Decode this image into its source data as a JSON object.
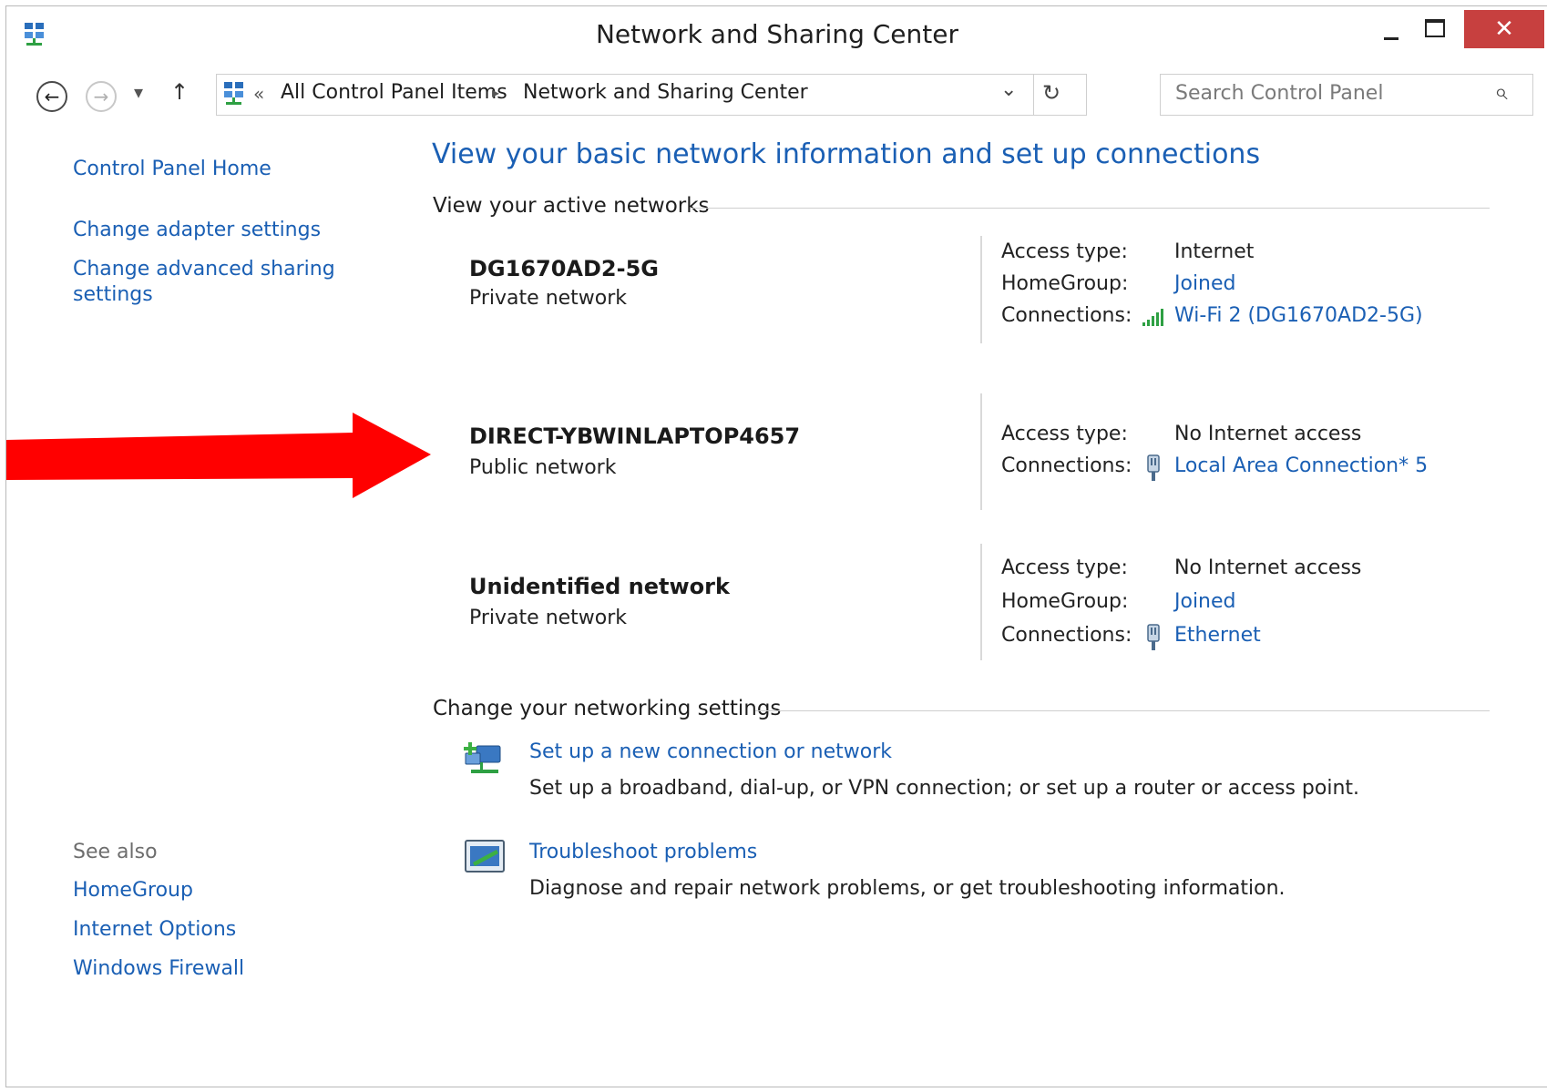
{
  "window": {
    "title": "Network and Sharing Center",
    "close_glyph": "✕"
  },
  "nav": {
    "back_glyph": "←",
    "forward_glyph": "→",
    "recent_glyph": "▾",
    "up_glyph": "↑",
    "breadcrumb_sep": "«",
    "crumb_arrow": "▸",
    "crumbs": [
      "All Control Panel Items",
      "Network and Sharing Center"
    ],
    "dropdown_glyph": "⌄",
    "refresh_glyph": "↻",
    "search_placeholder": "Search Control Panel",
    "search_glyph": "⌕"
  },
  "sidebar": {
    "home": "Control Panel Home",
    "adapter": "Change adapter settings",
    "advanced_line1": "Change advanced sharing",
    "advanced_line2": "settings",
    "see_also_label": "See also",
    "see_also": [
      "HomeGroup",
      "Internet Options",
      "Windows Firewall"
    ]
  },
  "main": {
    "heading": "View your basic network information and set up connections",
    "active_label": "View your active networks",
    "networks": [
      {
        "name": "DG1670AD2-5G",
        "type": "Private network",
        "access_label": "Access type:",
        "access": "Internet",
        "homegroup_label": "HomeGroup:",
        "homegroup": "Joined",
        "conn_label": "Connections:",
        "conn": "Wi-Fi 2 (DG1670AD2-5G)",
        "conn_icon": "wifi-signal-icon"
      },
      {
        "name": "DIRECT-YBWINLAPTOP4657",
        "type": "Public network",
        "access_label": "Access type:",
        "access": "No Internet access",
        "conn_label": "Connections:",
        "conn": "Local Area Connection* 5",
        "conn_icon": "ethernet-plug-icon"
      },
      {
        "name": "Unidentified network",
        "type": "Private network",
        "access_label": "Access type:",
        "access": "No Internet access",
        "homegroup_label": "HomeGroup:",
        "homegroup": "Joined",
        "conn_label": "Connections:",
        "conn": "Ethernet",
        "conn_icon": "ethernet-plug-icon"
      }
    ],
    "change_label": "Change your networking settings",
    "tasks": [
      {
        "title": "Set up a new connection or network",
        "desc": "Set up a broadband, dial-up, or VPN connection; or set up a router or access point.",
        "icon": "new-connection-icon"
      },
      {
        "title": "Troubleshoot problems",
        "desc": "Diagnose and repair network problems, or get troubleshooting information.",
        "icon": "troubleshoot-icon"
      }
    ]
  },
  "colors": {
    "link": "#1a5fb4",
    "close": "#c7403f",
    "arrow": "#ff0000"
  }
}
